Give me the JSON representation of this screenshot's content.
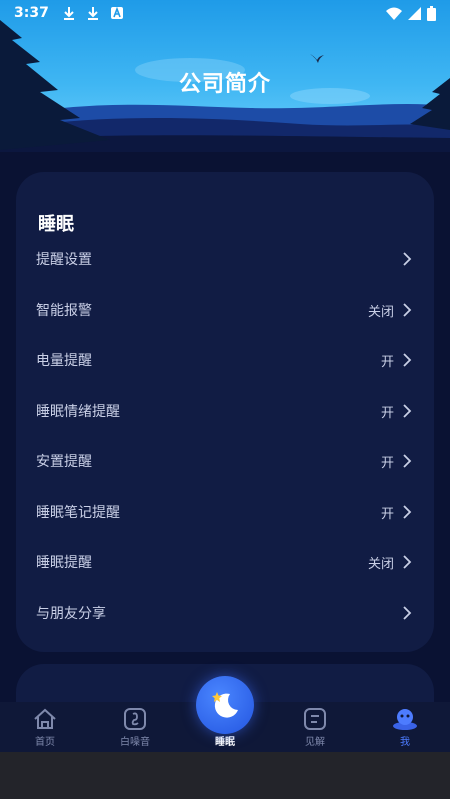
{
  "status_bar": {
    "time": "3:37"
  },
  "header": {
    "title": "公司简介"
  },
  "card": {
    "title": "睡眠",
    "items": [
      {
        "label": "提醒设置",
        "value": ""
      },
      {
        "label": "智能报警",
        "value": "关闭"
      },
      {
        "label": "电量提醒",
        "value": "开"
      },
      {
        "label": "睡眠情绪提醒",
        "value": "开"
      },
      {
        "label": "安置提醒",
        "value": "开"
      },
      {
        "label": "睡眠笔记提醒",
        "value": "开"
      },
      {
        "label": "睡眠提醒",
        "value": "关闭"
      },
      {
        "label": "与朋友分享",
        "value": ""
      }
    ]
  },
  "tabs": [
    {
      "label": "首页",
      "icon": "home-icon"
    },
    {
      "label": "白噪音",
      "icon": "white-noise-icon"
    },
    {
      "label": "睡眠",
      "icon": "moon-icon"
    },
    {
      "label": "见解",
      "icon": "insight-icon"
    },
    {
      "label": "我",
      "icon": "profile-icon"
    }
  ],
  "colors": {
    "accent": "#4d7cff",
    "card": "#111c44",
    "background": "#0a1233"
  }
}
